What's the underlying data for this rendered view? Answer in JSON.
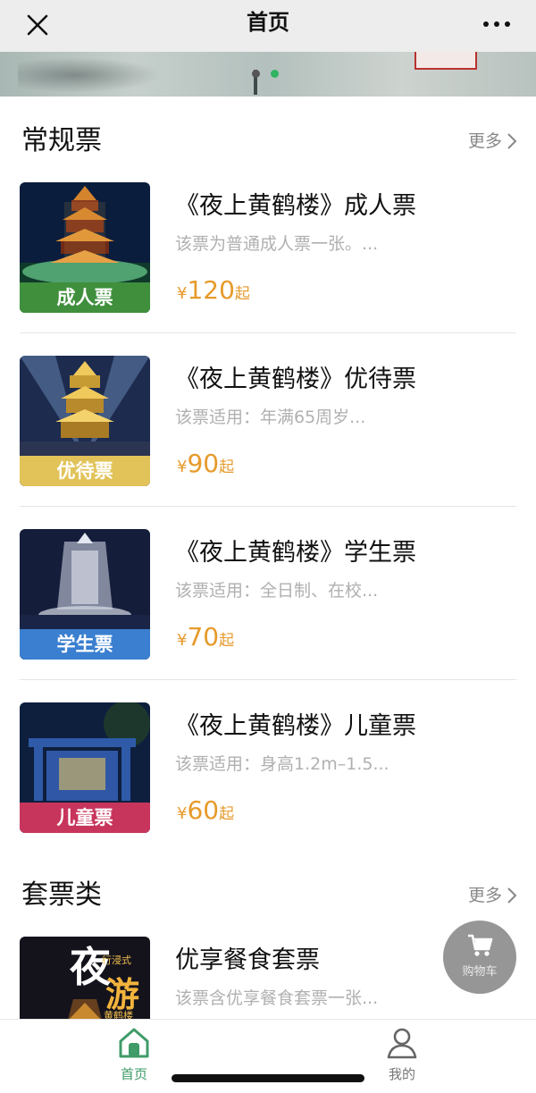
{
  "header": {
    "title": "首页"
  },
  "sections": {
    "regular": {
      "title": "常规票",
      "more": "更多"
    },
    "package": {
      "title": "套票类",
      "more": "更多"
    }
  },
  "tickets": [
    {
      "name": "《夜上黄鹤楼》成人票",
      "desc": "该票为普通成人票一张。...",
      "currency": "¥",
      "price": "120",
      "suffix": "起",
      "tag": "成人票",
      "tag_color": "#3f8f3c"
    },
    {
      "name": "《夜上黄鹤楼》优待票",
      "desc": "该票适用：年满65周岁...",
      "currency": "¥",
      "price": "90",
      "suffix": "起",
      "tag": "优待票",
      "tag_color": "#e2c35a"
    },
    {
      "name": "《夜上黄鹤楼》学生票",
      "desc": "该票适用：全日制、在校...",
      "currency": "¥",
      "price": "70",
      "suffix": "起",
      "tag": "学生票",
      "tag_color": "#3a7fd0"
    },
    {
      "name": "《夜上黄鹤楼》儿童票",
      "desc": "该票适用：身高1.2m–1.5...",
      "currency": "¥",
      "price": "60",
      "suffix": "起",
      "tag": "儿童票",
      "tag_color": "#c8355c"
    }
  ],
  "package_items": [
    {
      "name": "优享餐食套票",
      "desc": "该票含优享餐食套票一张...",
      "thumb_text_main": "夜",
      "thumb_text_sub1": "行浸式",
      "thumb_text_main2": "游",
      "thumb_text_sub2": "黄鹤楼"
    }
  ],
  "cart": {
    "label": "购物车"
  },
  "tabbar": {
    "home": "首页",
    "mine": "我的"
  },
  "colors": {
    "accent_green": "#3f9b68",
    "price_orange": "#e69a2b",
    "carousel_active": "#2fb361"
  }
}
